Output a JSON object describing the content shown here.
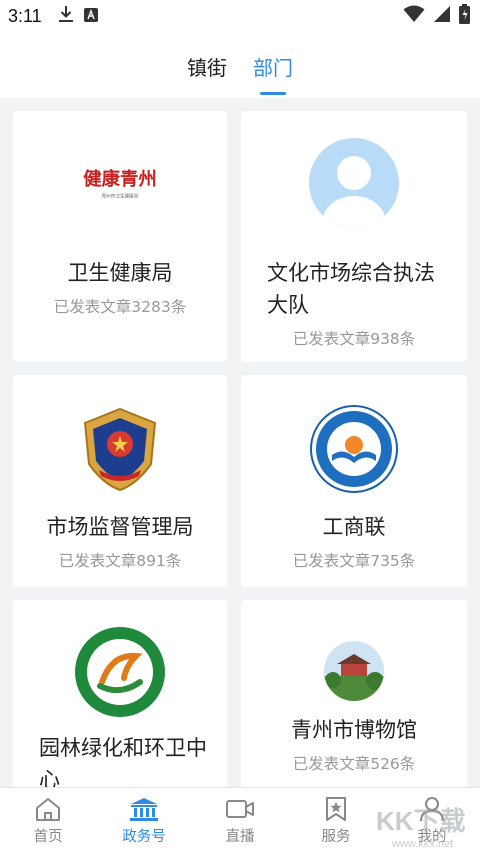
{
  "status_bar": {
    "time": "3:11"
  },
  "tabs": [
    {
      "label": "镇街",
      "active": false
    },
    {
      "label": "部门",
      "active": true
    }
  ],
  "departments": [
    {
      "name": "卫生健康局",
      "count_text": "已发表文章3283条",
      "logo": "health-bureau-logo",
      "logo_text": "健康青州",
      "logo_subtext": "青州市卫生健康局"
    },
    {
      "name": "文化市场综合执法大队",
      "count_text": "已发表文章938条",
      "logo": "default-avatar-icon"
    },
    {
      "name": "市场监督管理局",
      "count_text": "已发表文章891条",
      "logo": "market-supervision-emblem"
    },
    {
      "name": "工商联",
      "count_text": "已发表文章735条",
      "logo": "federation-emblem"
    },
    {
      "name": "园林绿化和环卫中心",
      "count_text": "",
      "logo": "landscaping-center-logo"
    },
    {
      "name": "青州市博物馆",
      "count_text": "已发表文章526条",
      "logo": "museum-photo"
    }
  ],
  "bottom_nav": [
    {
      "label": "首页",
      "icon": "home-icon",
      "active": false
    },
    {
      "label": "政务号",
      "icon": "government-building-icon",
      "active": true
    },
    {
      "label": "直播",
      "icon": "video-camera-icon",
      "active": false
    },
    {
      "label": "服务",
      "icon": "star-bookmark-icon",
      "active": false
    },
    {
      "label": "我的",
      "icon": "user-icon",
      "active": false
    }
  ],
  "colors": {
    "accent": "#2f8ae6",
    "background": "#f2f3f5",
    "muted_text": "#999999"
  },
  "watermark": {
    "text": "KK下载",
    "subtext": "www.kkx.net"
  }
}
